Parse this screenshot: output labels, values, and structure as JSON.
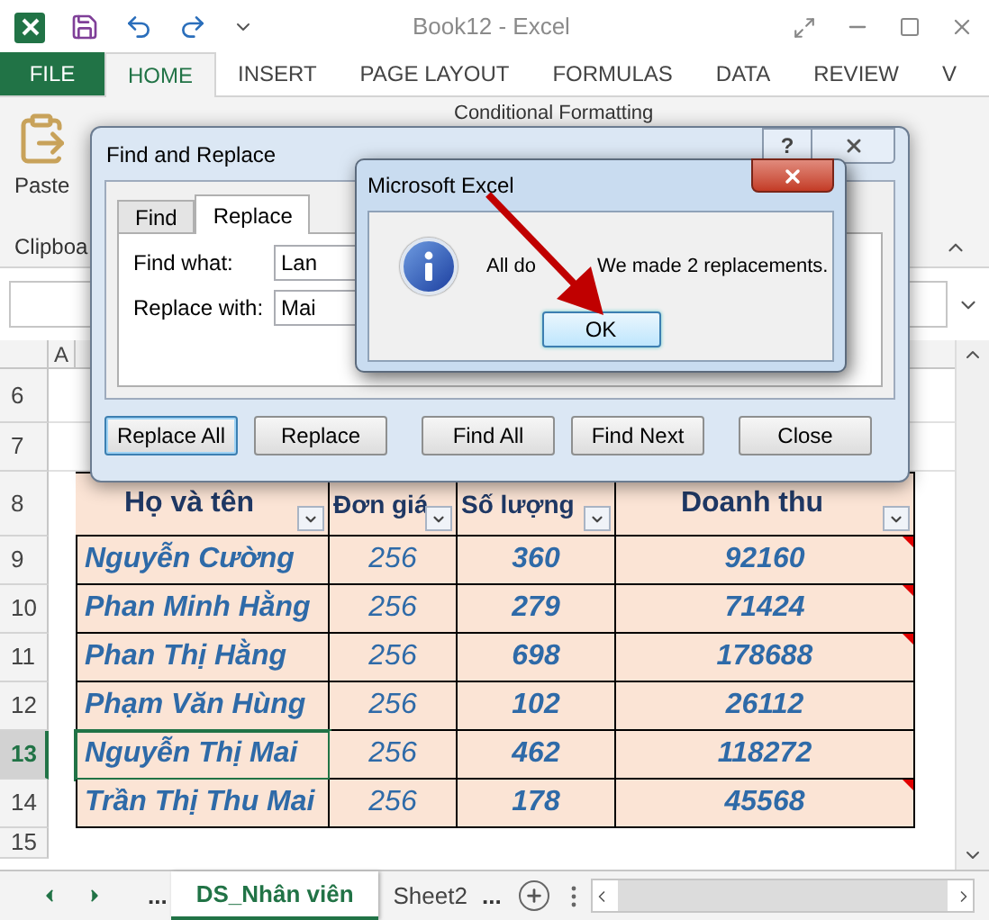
{
  "window": {
    "title": "Book12 - Excel"
  },
  "ribbon_tabs": [
    {
      "label": "FILE",
      "kind": "file",
      "selected": false
    },
    {
      "label": "HOME",
      "kind": "tab",
      "selected": true
    },
    {
      "label": "INSERT",
      "kind": "tab",
      "selected": false
    },
    {
      "label": "PAGE LAYOUT",
      "kind": "tab",
      "selected": false
    },
    {
      "label": "FORMULAS",
      "kind": "tab",
      "selected": false
    },
    {
      "label": "DATA",
      "kind": "tab",
      "selected": false
    },
    {
      "label": "REVIEW",
      "kind": "tab",
      "selected": false
    },
    {
      "label": "V",
      "kind": "tab",
      "selected": false
    }
  ],
  "ribbon": {
    "paste": "Paste",
    "group_label": "Clipboa",
    "conditional_formatting": "Conditional Formatting"
  },
  "column_header": "A",
  "sheet": {
    "rows_before": [
      "6",
      "7"
    ],
    "header_row": "8",
    "columns": [
      "Họ và tên",
      "Đơn giá",
      "Số lượng",
      "Doanh thu"
    ],
    "rows": [
      {
        "number": "9",
        "cells": [
          "Nguyễn Cường",
          "256",
          "360",
          "92160"
        ],
        "selected": false,
        "comment": true
      },
      {
        "number": "10",
        "cells": [
          "Phan  Minh Hằng",
          "256",
          "279",
          "71424"
        ],
        "selected": false,
        "comment": true
      },
      {
        "number": "11",
        "cells": [
          "Phan  Thị Hằng",
          "256",
          "698",
          "178688"
        ],
        "selected": false,
        "comment": true
      },
      {
        "number": "12",
        "cells": [
          "Phạm  Văn Hùng",
          "256",
          "102",
          "26112"
        ],
        "selected": false,
        "comment": false
      },
      {
        "number": "13",
        "cells": [
          "Nguyễn  Thị Mai",
          "256",
          "462",
          "118272"
        ],
        "selected": true,
        "comment": false
      },
      {
        "number": "14",
        "cells": [
          "Trần  Thị Thu Mai",
          "256",
          "178",
          "45568"
        ],
        "selected": false,
        "comment": true
      }
    ],
    "rows_after": [
      "15"
    ]
  },
  "sheet_tabs": {
    "overflow_left": "...",
    "tabs": [
      {
        "label": "DS_Nhân viên",
        "selected": true
      },
      {
        "label": "Sheet2",
        "selected": false
      }
    ],
    "overflow_right": "..."
  },
  "find_replace": {
    "title": "Find and Replace",
    "help": "?",
    "tabs": [
      {
        "label": "Find",
        "selected": false
      },
      {
        "label": "Replace",
        "selected": true
      }
    ],
    "fields": [
      {
        "label": "Find what:",
        "value": "Lan"
      },
      {
        "label": "Replace with:",
        "value": "Mai"
      }
    ],
    "buttons": [
      {
        "label": "Replace All",
        "selected": true
      },
      {
        "label": "Replace",
        "selected": false
      },
      {
        "label": "Find All",
        "selected": false
      },
      {
        "label": "Find Next",
        "selected": false
      },
      {
        "label": "Close",
        "selected": false
      }
    ]
  },
  "message_box": {
    "title": "Microsoft Excel",
    "text_parts": [
      "All do",
      "We made 2 replacements."
    ],
    "button": "OK"
  }
}
